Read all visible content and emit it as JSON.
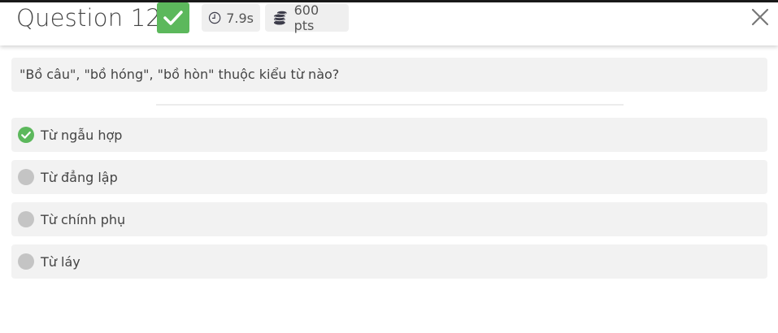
{
  "header": {
    "title": "Question 12",
    "result_icon": "check-icon",
    "time": "7.9s",
    "time_icon": "clock-icon",
    "points": "600 pts",
    "points_icon": "coins-icon",
    "close_icon": "close-icon"
  },
  "question": {
    "text": "\"Bồ câu\", \"bồ hóng\", \"bồ hòn\" thuộc kiểu từ nào?"
  },
  "answers": [
    {
      "label": "Từ ngẫu hợp",
      "state": "correct",
      "icon": "check-circle-icon"
    },
    {
      "label": "Từ đẳng lập",
      "state": "unselected",
      "icon": "circle-icon"
    },
    {
      "label": "Từ chính phụ",
      "state": "unselected",
      "icon": "circle-icon"
    },
    {
      "label": "Từ láy",
      "state": "unselected",
      "icon": "circle-icon"
    }
  ],
  "colors": {
    "correct_green": "#5cb85c",
    "option_bg": "#f2f2f2",
    "neutral_dot": "#c4c4c4"
  }
}
